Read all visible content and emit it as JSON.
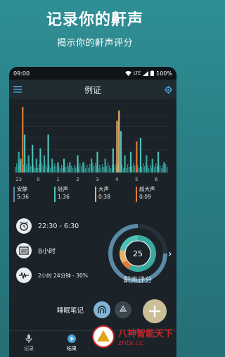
{
  "hero": {
    "title": "记录你的鼾声",
    "subtitle": "揭示你的鼾声评分"
  },
  "status_bar": {
    "time": "09:00",
    "network": "LTE",
    "battery": "100%"
  },
  "header": {
    "title": "例证",
    "menu_icon": "menu-icon",
    "settings_icon": "gear-icon"
  },
  "chart_data": {
    "type": "bar",
    "x_tick_labels": [
      "23",
      "0",
      "1",
      "2",
      "3",
      "4",
      "5",
      "6"
    ],
    "note": "sound level bars over the night; tall spikes near 23, 0, 4 and 5",
    "categories_colors": {
      "quiet": "#3aa9a0",
      "light": "#4fc1b6",
      "loud": "#e6b170",
      "epic": "#e07a3a"
    },
    "series": [
      {
        "hour": 23.0,
        "level": 0.3,
        "kind": "quiet"
      },
      {
        "hour": 23.1,
        "level": 0.2,
        "kind": "light"
      },
      {
        "hour": 23.2,
        "level": 0.95,
        "kind": "epic"
      },
      {
        "hour": 23.3,
        "level": 0.55,
        "kind": "light"
      },
      {
        "hour": 23.5,
        "level": 0.25,
        "kind": "quiet"
      },
      {
        "hour": 23.7,
        "level": 0.4,
        "kind": "light"
      },
      {
        "hour": 23.9,
        "level": 0.2,
        "kind": "quiet"
      },
      {
        "hour": 24.1,
        "level": 0.35,
        "kind": "light"
      },
      {
        "hour": 24.3,
        "level": 0.25,
        "kind": "quiet"
      },
      {
        "hour": 24.5,
        "level": 0.55,
        "kind": "light"
      },
      {
        "hour": 24.7,
        "level": 0.2,
        "kind": "quiet"
      },
      {
        "hour": 25.0,
        "level": 0.15,
        "kind": "quiet"
      },
      {
        "hour": 25.3,
        "level": 0.2,
        "kind": "light"
      },
      {
        "hour": 25.6,
        "level": 0.15,
        "kind": "quiet"
      },
      {
        "hour": 26.0,
        "level": 0.25,
        "kind": "light"
      },
      {
        "hour": 26.3,
        "level": 0.15,
        "kind": "quiet"
      },
      {
        "hour": 26.7,
        "level": 0.2,
        "kind": "quiet"
      },
      {
        "hour": 27.0,
        "level": 0.3,
        "kind": "light"
      },
      {
        "hour": 27.4,
        "level": 0.2,
        "kind": "quiet"
      },
      {
        "hour": 27.8,
        "level": 0.35,
        "kind": "light"
      },
      {
        "hour": 28.0,
        "level": 0.75,
        "kind": "loud"
      },
      {
        "hour": 28.1,
        "level": 0.9,
        "kind": "loud"
      },
      {
        "hour": 28.2,
        "level": 0.6,
        "kind": "light"
      },
      {
        "hour": 28.4,
        "level": 0.25,
        "kind": "quiet"
      },
      {
        "hour": 28.7,
        "level": 0.3,
        "kind": "light"
      },
      {
        "hour": 29.0,
        "level": 0.45,
        "kind": "epic"
      },
      {
        "hour": 29.2,
        "level": 0.5,
        "kind": "light"
      },
      {
        "hour": 29.5,
        "level": 0.25,
        "kind": "quiet"
      },
      {
        "hour": 29.8,
        "level": 0.2,
        "kind": "quiet"
      },
      {
        "hour": 30.1,
        "level": 0.3,
        "kind": "light"
      },
      {
        "hour": 30.4,
        "level": 0.15,
        "kind": "quiet"
      }
    ],
    "grid": true
  },
  "legend": [
    {
      "label": "安静",
      "duration": "5:36",
      "color": "#5b8aa6"
    },
    {
      "label": "轻声",
      "duration": "1:36",
      "color": "#4fc1b6"
    },
    {
      "label": "大声",
      "duration": "0:38",
      "color": "#e6b170"
    },
    {
      "label": "超大声",
      "duration": "0:09",
      "color": "#e07a3a"
    }
  ],
  "info": {
    "time_range": "22:30 - 6:30",
    "duration": "8小时",
    "snore_summary": "2小时 24分钟 - 30%"
  },
  "score": {
    "value": "25",
    "label": "鼾声评分",
    "fraction": 0.25
  },
  "notes": {
    "label": "睡眠笔记"
  },
  "nav": {
    "record_label": "记录",
    "results_label": "结果"
  },
  "watermark": {
    "line1": "八神智能天下",
    "line2": "zntx.cc"
  }
}
